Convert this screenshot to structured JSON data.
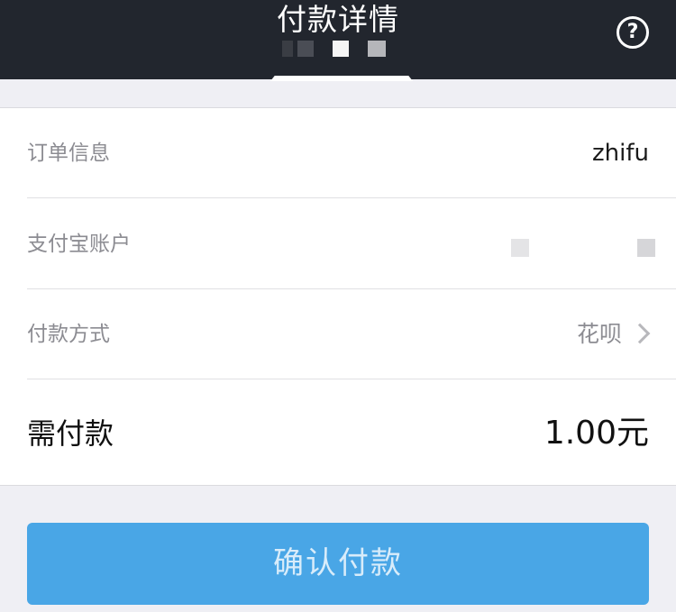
{
  "header": {
    "title": "付款详情",
    "help_glyph": "?"
  },
  "rows": [
    {
      "label": "订单信息",
      "value": "zhifu"
    },
    {
      "label": "支付宝账户",
      "value": ""
    },
    {
      "label": "付款方式",
      "value": "花呗"
    }
  ],
  "amount": {
    "label": "需付款",
    "value": "1.00元"
  },
  "confirm_button": {
    "label": "确认付款"
  },
  "colors": {
    "header_bg": "#22262e",
    "button_bg": "#49a6e6",
    "page_bg": "#efeff4"
  },
  "icons": {
    "help": "question-circle-icon",
    "chevron": "chevron-right-icon"
  }
}
